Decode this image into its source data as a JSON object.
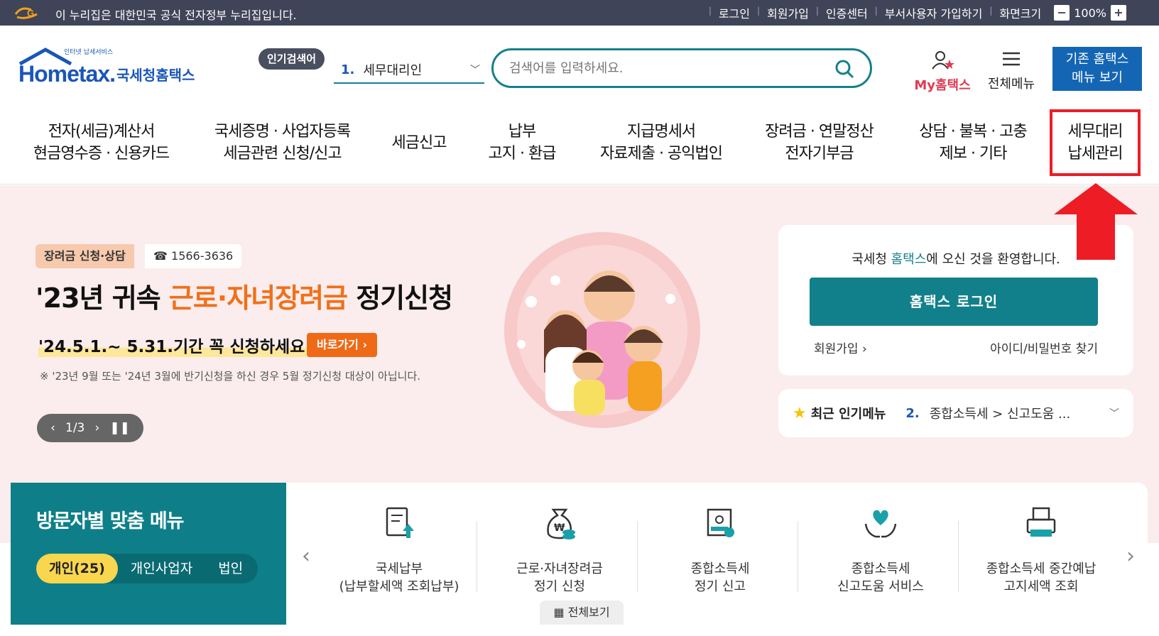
{
  "govbar": {
    "notice": "이 누리집은 대한민국 공식 전자정부 누리집입니다.",
    "links": [
      "로그인",
      "회원가입",
      "인증센터",
      "부서사용자 가입하기",
      "화면크기"
    ],
    "zoom_minus": "−",
    "zoom_value": "100%",
    "zoom_plus": "+"
  },
  "header": {
    "logo_small": "인터넷 납세서비스",
    "logo_main": "Hometax.",
    "logo_kr": "국세청홈택스",
    "hot_tag": "인기검색어",
    "hot_num": "1.",
    "hot_value": "세무대리인",
    "search_placeholder": "검색어를 입력하세요.",
    "mytax_label": "My홈택스",
    "allmenu_label": "전체메뉴",
    "legacy_line1": "기존 홈택스",
    "legacy_line2": "메뉴 보기"
  },
  "nav": [
    {
      "line1": "전자(세금)계산서",
      "line2": "현금영수증 · 신용카드"
    },
    {
      "line1": "국세증명 · 사업자등록",
      "line2": "세금관련 신청/신고"
    },
    {
      "line1": "세금신고",
      "line2": ""
    },
    {
      "line1": "납부",
      "line2": "고지 · 환급"
    },
    {
      "line1": "지급명세서",
      "line2": "자료제출 · 공익법인"
    },
    {
      "line1": "장려금 · 연말정산",
      "line2": "전자기부금"
    },
    {
      "line1": "상담 · 불복 · 고충",
      "line2": "제보 · 기타"
    },
    {
      "line1": "세무대리",
      "line2": "납세관리"
    }
  ],
  "hero": {
    "pill": "장려금 신청·상담",
    "phone": "☎ 1566-3636",
    "headline_pre": "'23년 귀속 ",
    "headline_hl": "근로·자녀장려금",
    "headline_post": " 정기신청",
    "subline": "'24.5.1.~ 5.31.기간 꼭 신청하세요!",
    "go_button": "바로가기 ›",
    "note": "※ '23년 9월 또는 '24년 3월에 반기신청을 하신 경우 5월 정기신청 대상이 아닙니다.",
    "pager": "1/3"
  },
  "login": {
    "welcome_pre": "국세청 ",
    "welcome_acc": "홈택스",
    "welcome_post": "에 오신 것을 환영합니다.",
    "button": "홈택스 로그인",
    "join": "회원가입 ›",
    "find": "아이디/비밀번호 찾기"
  },
  "popular": {
    "title": "최근 인기메뉴",
    "num": "2.",
    "text": "종합소득세 > 신고도움 ..."
  },
  "visitor": {
    "title": "방문자별 맞춤 메뉴",
    "tabs": [
      "개인(25)",
      "개인사업자",
      "법인"
    ]
  },
  "quick": [
    {
      "line1": "국세납부",
      "line2": "(납부할세액 조회납부)",
      "icon": "document-upload-icon"
    },
    {
      "line1": "근로·자녀장려금",
      "line2": "정기 신청",
      "icon": "money-bag-icon"
    },
    {
      "line1": "종합소득세",
      "line2": "정기 신고",
      "icon": "certificate-icon"
    },
    {
      "line1": "종합소득세",
      "line2": "신고도움 서비스",
      "icon": "heart-hands-icon"
    },
    {
      "line1": "종합소득세 중간예납",
      "line2": "고지세액 조회",
      "icon": "printer-icon"
    }
  ],
  "view_all": "전체보기",
  "colors": {
    "accent": "#11808a",
    "highlight": "#ee1c25",
    "govbar": "#3f4458"
  }
}
